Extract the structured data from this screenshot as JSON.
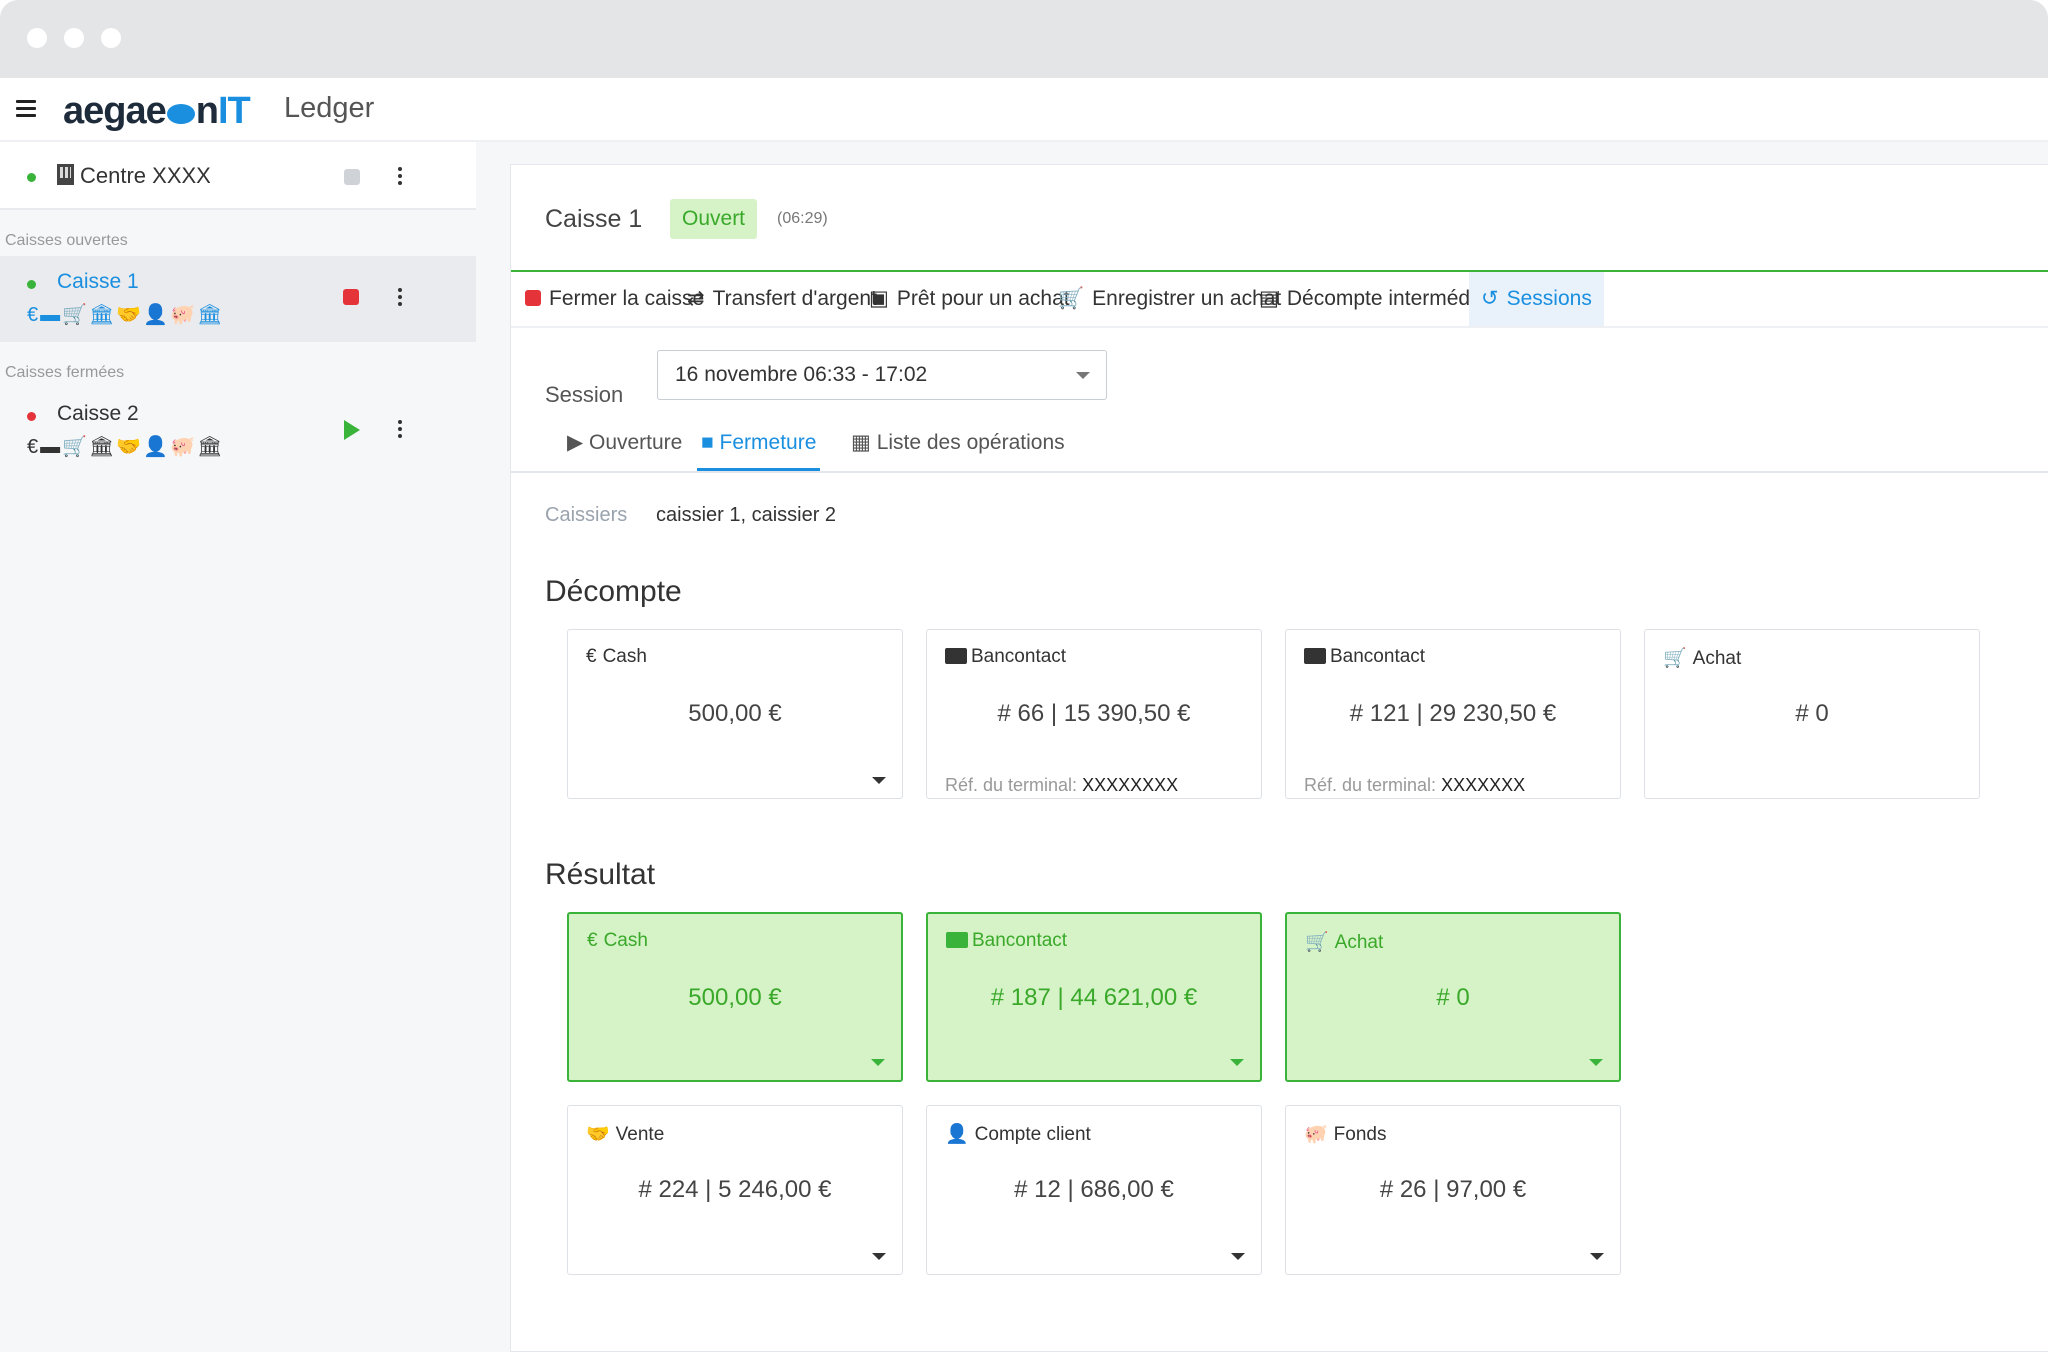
{
  "app": {
    "logo_main": "aegae",
    "logo_n": "n",
    "logo_it": "IT",
    "title": "Ledger"
  },
  "sidebar": {
    "center": {
      "name": "Centre XXXX"
    },
    "open_label": "Caisses ouvertes",
    "closed_label": "Caisses fermées",
    "open_items": [
      {
        "name": "Caisse 1",
        "icons": "€▬🛒🏛🤝👤🐖🏛"
      }
    ],
    "closed_items": [
      {
        "name": "Caisse 2",
        "icons": "€▬🛒🏛🤝👤🐖🏛"
      }
    ]
  },
  "panel": {
    "title": "Caisse 1",
    "status": "Ouvert",
    "duration": "(06:29)",
    "toolbar": {
      "close": "Fermer la caisse",
      "transfer": "Transfert d'argent",
      "loan": "Prêt pour un achat",
      "register_purchase": "Enregistrer un achat",
      "interim_count": "Décompte intermédiaire",
      "sessions": "Sessions"
    },
    "session_label": "Session",
    "session_value": "16 novembre 06:33 - 17:02",
    "subtabs": {
      "opening": "Ouverture",
      "closing": "Fermeture",
      "operations": "Liste des opérations"
    },
    "cashiers_label": "Caissiers",
    "cashiers_value": "caissier 1, caissier 2",
    "decompte_title": "Décompte",
    "decompte": [
      {
        "title": "Cash",
        "icon": "euro-icon",
        "value": "500,00 €"
      },
      {
        "title": "Bancontact",
        "icon": "card-icon",
        "value": "# 66 | 15 390,50 €",
        "ref_label": "Réf. du terminal:",
        "ref_value": "XXXXXXXX"
      },
      {
        "title": "Bancontact",
        "icon": "card-icon",
        "value": "# 121 | 29 230,50 €",
        "ref_label": "Réf. du terminal:",
        "ref_value": "XXXXXXX"
      },
      {
        "title": "Achat",
        "icon": "cart-icon",
        "value": "# 0"
      }
    ],
    "resultat_title": "Résultat",
    "resultat": [
      {
        "title": "Cash",
        "icon": "euro-icon",
        "value": "500,00 €"
      },
      {
        "title": "Bancontact",
        "icon": "card-icon",
        "value": "# 187 | 44 621,00 €"
      },
      {
        "title": "Achat",
        "icon": "cart-icon",
        "value": "# 0"
      },
      {
        "title": "Vente",
        "icon": "handshake-icon",
        "value": "# 224 | 5 246,00 €"
      },
      {
        "title": "Compte client",
        "icon": "user-icon",
        "value": "# 12 | 686,00 €"
      },
      {
        "title": "Fonds",
        "icon": "piggy-bank-icon",
        "value": "# 26 | 97,00 €"
      }
    ]
  },
  "colors": {
    "accent": "#1a8fe0",
    "success": "#3ab33a",
    "danger": "#e5333a",
    "success_bg": "#d5f3c7"
  }
}
